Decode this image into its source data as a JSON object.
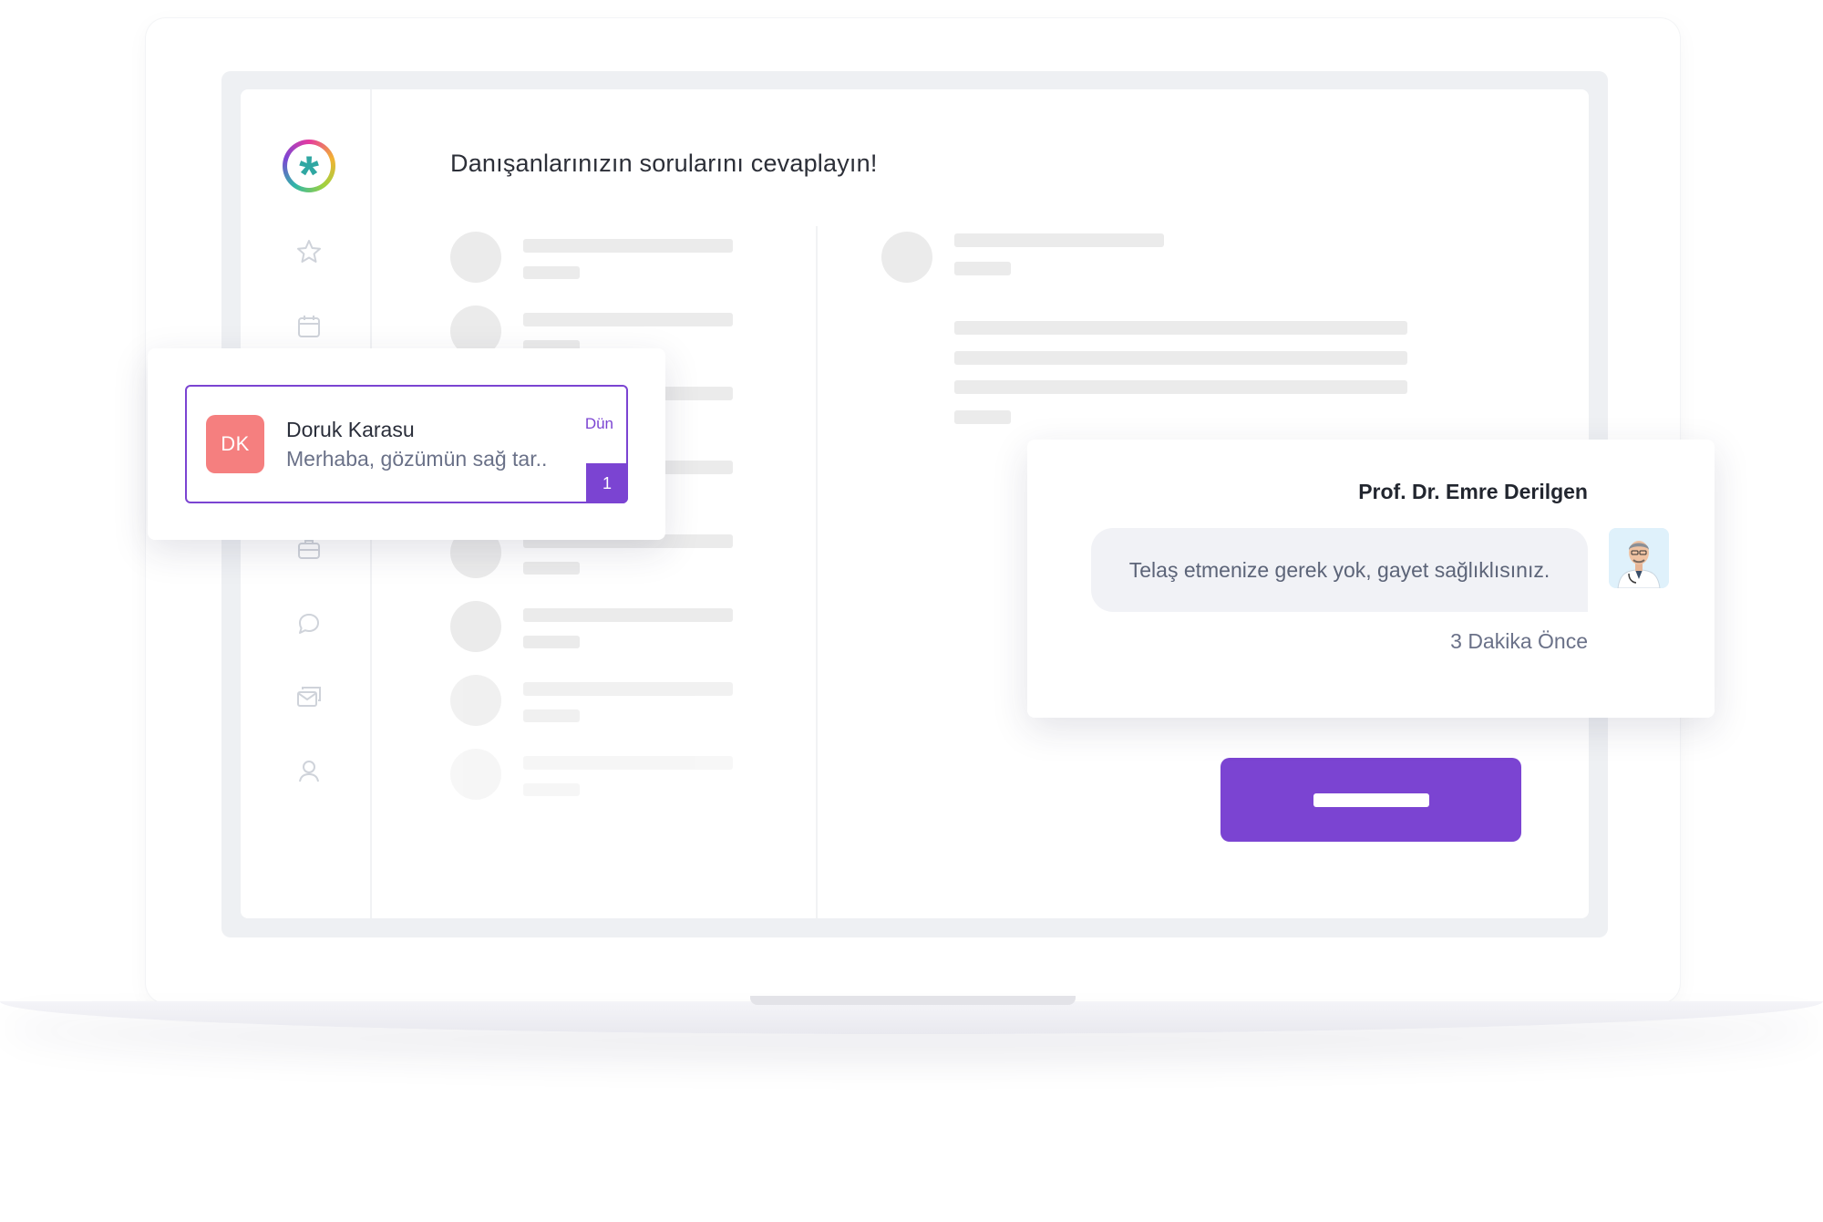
{
  "page": {
    "title": "Danışanlarınızın sorularını cevaplayın!"
  },
  "sidebar": {
    "logo": "asterisk-logo",
    "icons": [
      "star-icon",
      "calendar-icon",
      "briefcase-icon",
      "chat-icon",
      "messages-icon",
      "user-icon"
    ]
  },
  "message_card": {
    "sender_initials": "DK",
    "sender_name": "Doruk Karasu",
    "preview": "Merhaba, gözümün sağ tar..",
    "time": "Dün",
    "unread_count": "1"
  },
  "reply_card": {
    "doctor_name": "Prof. Dr. Emre Derilgen",
    "message": "Telaş etmenize gerek yok, gayet sağlıklısınız.",
    "timestamp": "3 Dakika Önce"
  },
  "colors": {
    "accent": "#7b44d2",
    "avatar_bg": "#f57f7f",
    "skeleton": "#ebebeb",
    "bubble_bg": "#f1f2f6"
  }
}
